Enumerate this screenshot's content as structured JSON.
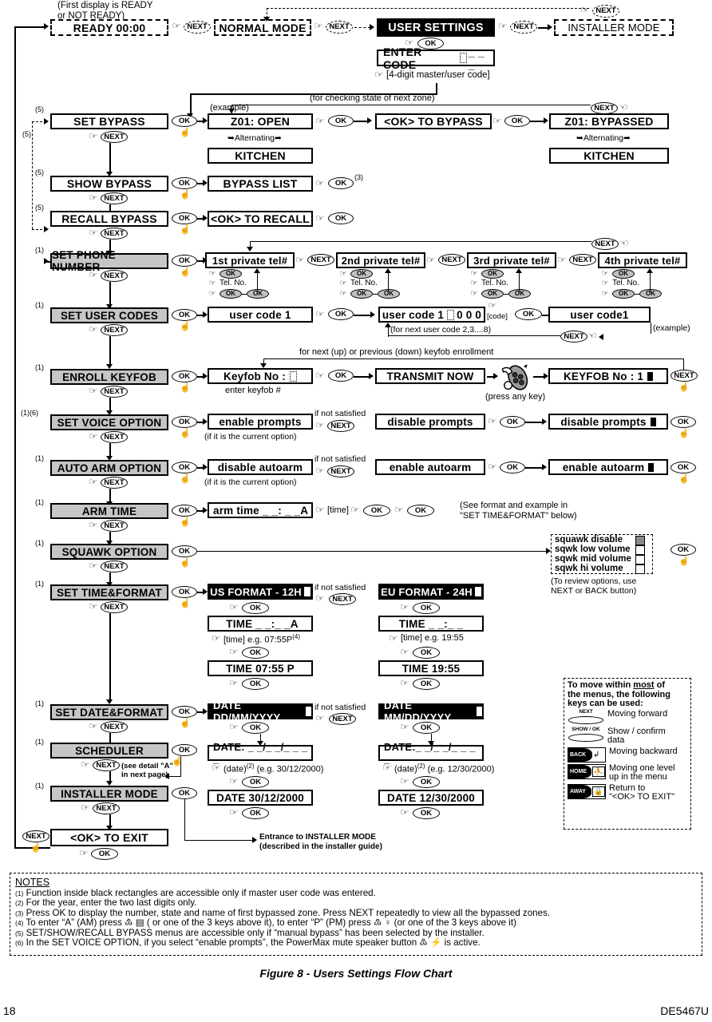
{
  "figure": {
    "caption": "Figure 8 - Users Settings Flow Chart",
    "page_number": "18",
    "doc_code": "DE5467U"
  },
  "keys": {
    "next": "NEXT",
    "ok": "OK"
  },
  "top_row": {
    "note_first_display_l1": "(First display is READY",
    "note_first_display_l2": "or NOT READY)",
    "ready": "READY 00:00",
    "normal_mode": "NORMAL MODE",
    "user_settings": "USER SETTINGS",
    "installer_mode": "INSTALLER MODE",
    "enter_code": "ENTER CODE",
    "enter_code_mask": "_ _ _",
    "code_hint": "[4-digit master/user code]"
  },
  "bypass": {
    "checking_note": "(for checking state of next zone)",
    "example_label": "(example)",
    "alternating": "Alternating",
    "set_bypass": "SET BYPASS",
    "z01_open": "Z01: OPEN",
    "kitchen": "KITCHEN",
    "ok_to_bypass": "<OK> TO BYPASS",
    "z01_bypassed": "Z01: BYPASSED",
    "show_bypass": "SHOW BYPASS",
    "bypass_list": "BYPASS LIST",
    "note3": "(3)",
    "recall_bypass": "RECALL BYPASS",
    "ok_to_recall": "<OK> TO RECALL"
  },
  "phone": {
    "menu": "SET PHONE NUMBER",
    "entries": [
      "1st private tel#",
      "2nd private tel#",
      "3rd private tel#",
      "4th private tel#"
    ],
    "sub_tel_label": "Tel. No."
  },
  "user_codes": {
    "menu": "SET USER CODES",
    "step1": "user code 1",
    "step2_prefix": "user code 1",
    "step2_digits": "0 0 0",
    "code_label": "[code]",
    "step3": "user code1",
    "example_label": "(example)",
    "loop_note": "(for next user code 2,3....8)"
  },
  "keyfob": {
    "menu": "ENROLL KEYFOB",
    "prompt": "Keyfob No :",
    "enter_hint": "enter keyfob #",
    "transmit": "TRANSMIT NOW",
    "press_any_key": "(press any key)",
    "result": "KEYFOB No : 1",
    "loop_note": "for next (up) or previous (down)  keyfob enrollment"
  },
  "voice": {
    "menu": "SET VOICE OPTION",
    "opt_current": "enable prompts",
    "current_hint": "(if it is the current option)",
    "not_satisfied": "if not satisfied",
    "opt_other": "disable prompts",
    "opt_confirm": "disable prompts"
  },
  "autoarm": {
    "menu": "AUTO ARM OPTION",
    "opt_current": "disable autoarm",
    "current_hint": "(if it is the current option)",
    "not_satisfied": "if not satisfied",
    "opt_other": "enable autoarm",
    "opt_confirm": "enable autoarm"
  },
  "armtime": {
    "menu": "ARM TIME",
    "field": "arm time _ _: _ _A",
    "time_label": "[time]",
    "see_format_l1": "(See format and example in",
    "see_format_l2": "\"SET TIME&FORMAT\" below)"
  },
  "squawk": {
    "menu": "SQUAWK OPTION",
    "options": [
      {
        "label": "squawk disable",
        "selected": true
      },
      {
        "label": "sqwk low volume",
        "selected": false
      },
      {
        "label": "sqwk mid volume",
        "selected": false
      },
      {
        "label": "sqwk hi volume",
        "selected": false
      }
    ],
    "review_l1": "(To review options, use",
    "review_l2": "NEXT or BACK button)"
  },
  "time_format": {
    "menu": "SET TIME&FORMAT",
    "not_satisfied": "if not satisfied",
    "us": {
      "format": "US FORMAT - 12H",
      "field": "TIME _ _:_ _A",
      "hint": "[time] e.g. 07:55P",
      "hint_sup": "(4)",
      "result": "TIME 07:55 P"
    },
    "eu": {
      "format": "EU FORMAT - 24H",
      "field": "TIME _ _:_ _",
      "hint": "[time] e.g. 19:55",
      "result": "TIME 19:55"
    }
  },
  "date_format": {
    "menu": "SET DATE&FORMAT",
    "not_satisfied": "if not satisfied",
    "ddmm": {
      "format": "DATE DD/MM/YYYY",
      "field": "DATE: _ _/_ _/_ _ _ _",
      "hint": "(date)",
      "hint_sup": "(2)",
      "hint2": "(e.g. 30/12/2000)",
      "result": "DATE 30/12/2000"
    },
    "mmdd": {
      "format": "DATE MM/DD/YYYY",
      "field": "DATE:_ _/_ _/_ _ _ _",
      "hint": "(date)",
      "hint_sup": "(2)",
      "hint2": "(e.g. 12/30/2000)",
      "result": "DATE 12/30/2000"
    }
  },
  "scheduler": {
    "menu": "SCHEDULER",
    "detail_l1": "(see detail \"A\"",
    "detail_l2": "in next page)"
  },
  "installer": {
    "menu": "INSTALLER MODE",
    "entrance_l1": "Entrance to INSTALLER MODE",
    "entrance_l2": "(described in the installer guide)"
  },
  "exit": {
    "label": "<OK> TO EXIT"
  },
  "legend": {
    "title_l1": "To move within most of",
    "title_l2": "the menus, the following",
    "title_l3": "keys can be used:",
    "rows": [
      {
        "key": "NEXT",
        "kind": "oval-top",
        "desc_l1": "Moving forward",
        "desc_l2": ""
      },
      {
        "key": "SHOW / OK",
        "kind": "oval-top",
        "desc_l1": "Show / confirm",
        "desc_l2": "data"
      },
      {
        "key": "BACK",
        "kind": "wedge",
        "desc_l1": "Moving backward",
        "desc_l2": ""
      },
      {
        "key": "HOME",
        "kind": "wedge",
        "desc_l1": "Moving one level",
        "desc_l2": "up in the menu"
      },
      {
        "key": "AWAY",
        "kind": "wedge",
        "desc_l1": "Return to",
        "desc_l2": "\"<OK> TO EXIT\""
      }
    ]
  },
  "notes": {
    "header": "NOTES",
    "items": [
      {
        "n": "(1)",
        "text": "Function inside black rectangles are accessible only if master user code was entered."
      },
      {
        "n": "(2)",
        "text": "For the year, enter the two last digits only."
      },
      {
        "n": "(3)",
        "text": "Press OK to display the number, state and name of first bypassed zone. Press NEXT repeatedly to view all the bypassed zones."
      },
      {
        "n": "(4)",
        "text": "To enter “A” (AM) press ♳ ▤ ( or one of the 3 keys above it), to enter “P” (PM) press ♳ ♀  (or one of the 3 keys above it)"
      },
      {
        "n": "(5)",
        "text": "SET/SHOW/RECALL BYPASS menus are accessible only if “manual bypass” has been selected by the installer."
      },
      {
        "n": "(6)",
        "text": "In the SET VOICE OPTION, if you select “enable prompts”, the PowerMax mute speaker button ♳ ⚡ is active."
      }
    ]
  },
  "markers": {
    "n1": "(1)",
    "n5": "(5)",
    "n16": "(1)(6)",
    "n3": "(3)"
  }
}
